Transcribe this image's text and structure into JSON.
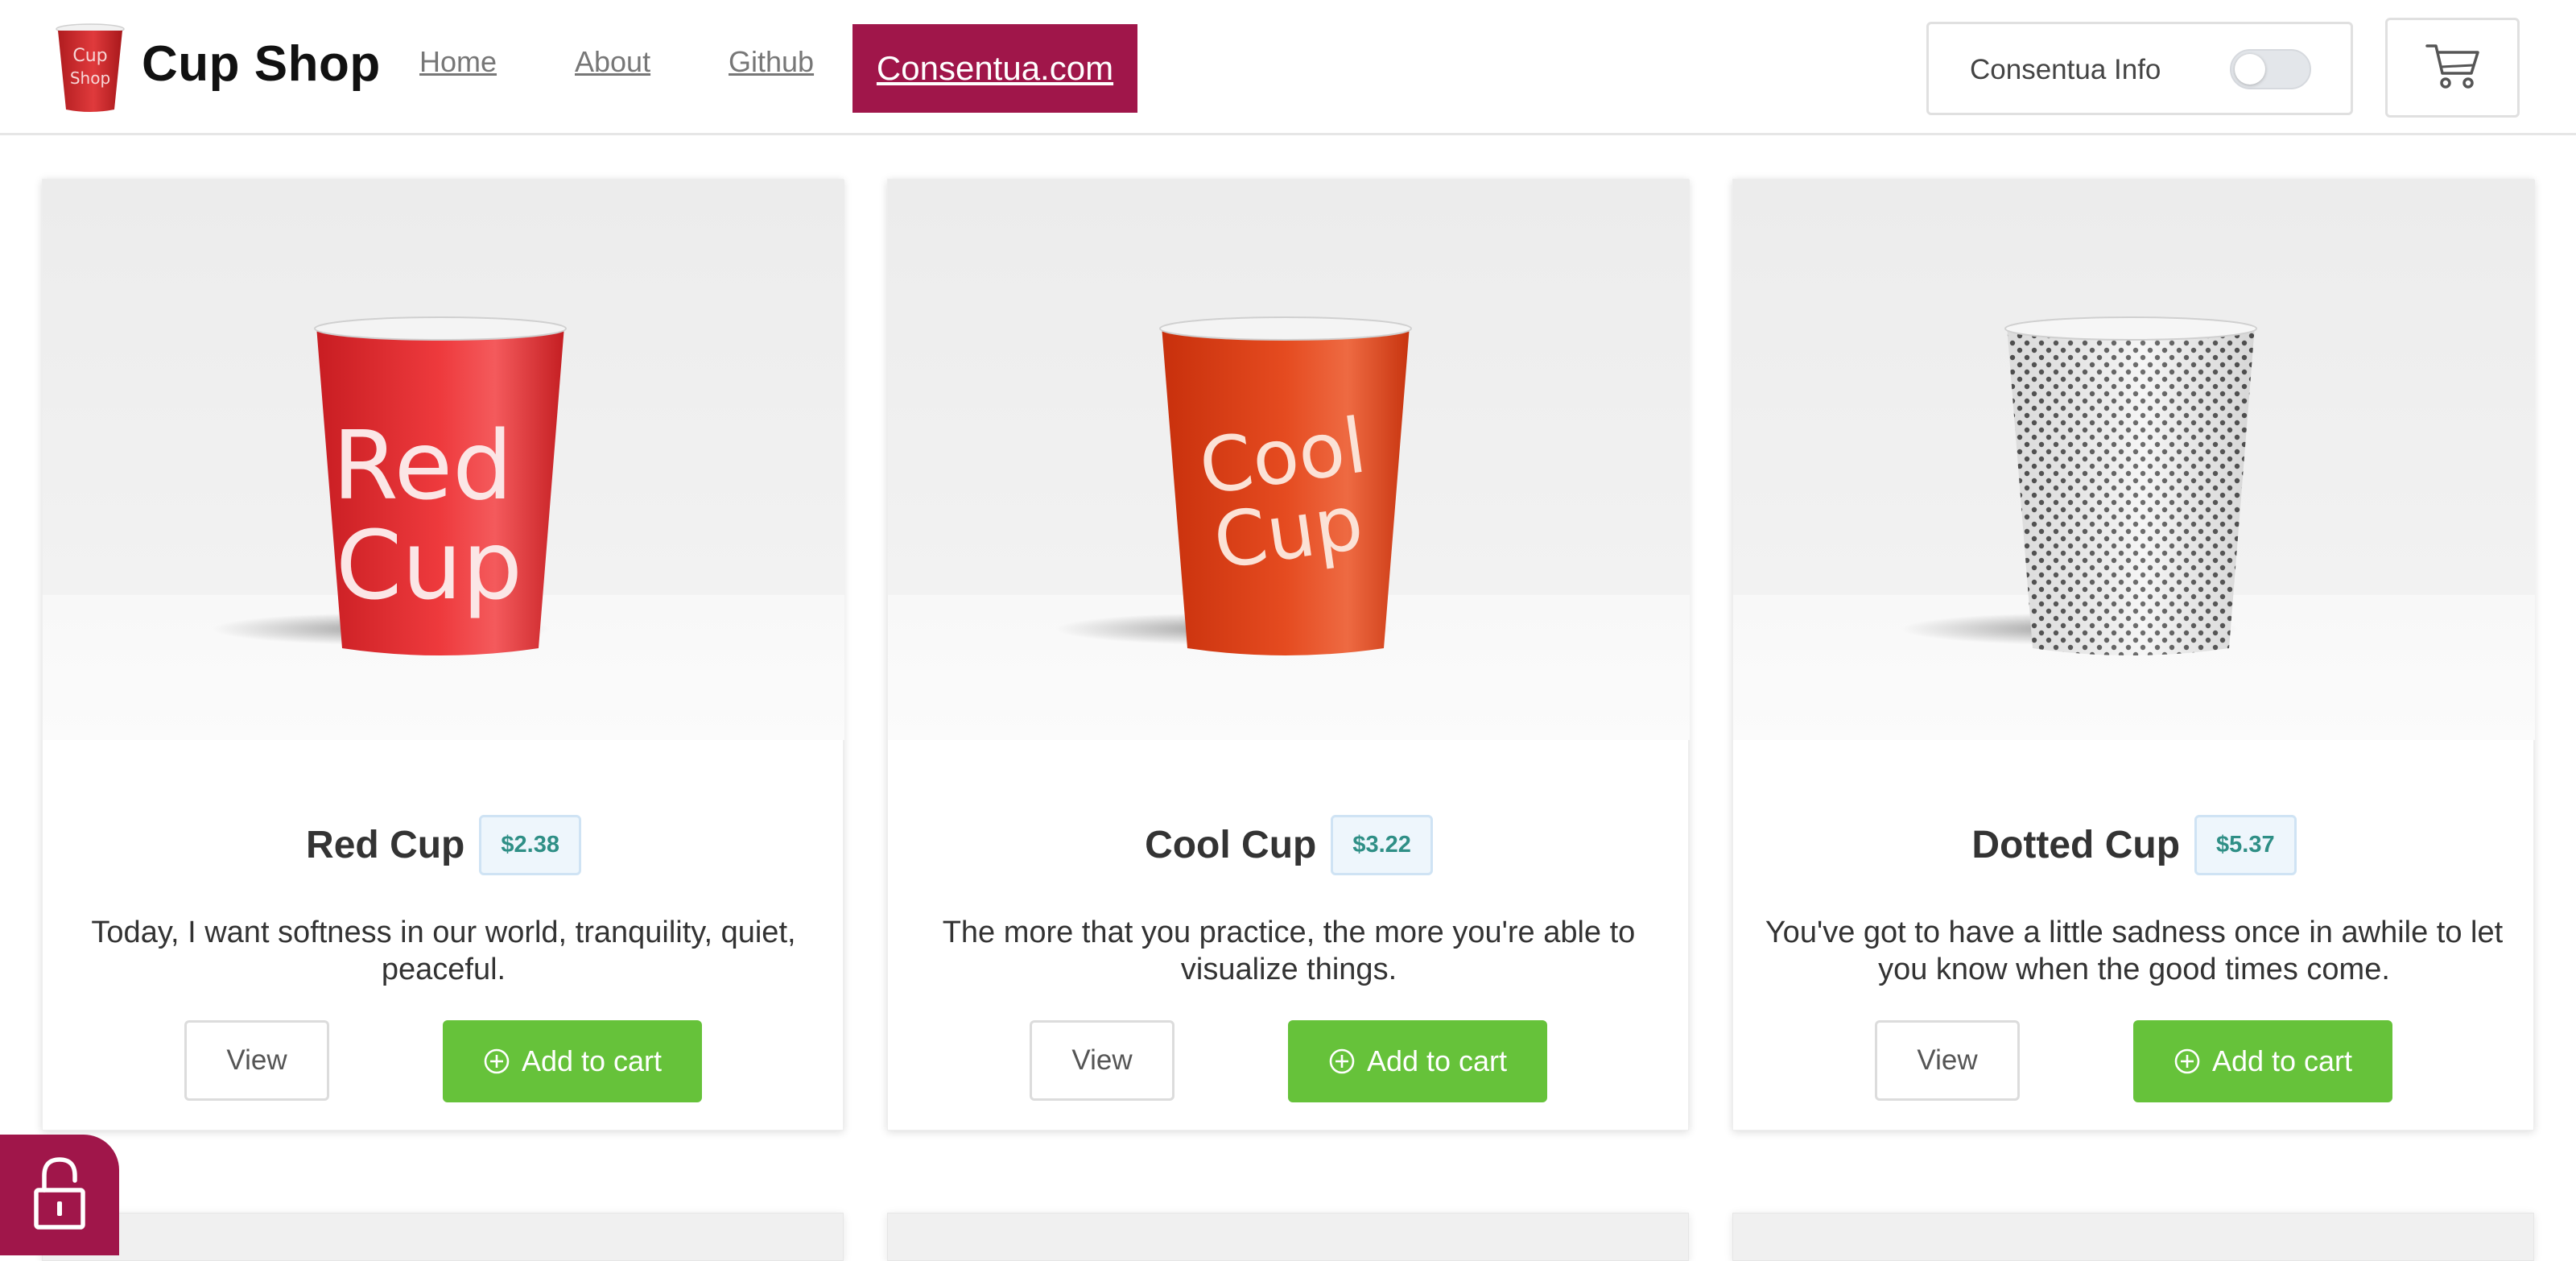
{
  "header": {
    "logo_text_line1": "Cup",
    "logo_text_line2": "Shop",
    "brand": "Cup Shop",
    "nav": {
      "home": "Home",
      "about": "About",
      "github": "Github",
      "consentua": "Consentua.com"
    },
    "consentua_info_label": "Consentua Info",
    "consentua_info_enabled": false,
    "cart_icon": "shopping-cart-icon"
  },
  "products": [
    {
      "name": "Red Cup",
      "price": "$2.38",
      "description": "Today, I want softness in our world, tranquility, quiet, peaceful.",
      "cup_text_line1": "Red",
      "cup_text_line2": "Cup",
      "cup_color": "#e8262a",
      "view_label": "View",
      "add_label": "Add to cart"
    },
    {
      "name": "Cool Cup",
      "price": "$3.22",
      "description": "The more that you practice, the more you're able to visualize things.",
      "cup_text_line1": "Cool",
      "cup_text_line2": "Cup",
      "cup_color": "#e24a1c",
      "view_label": "View",
      "add_label": "Add to cart"
    },
    {
      "name": "Dotted Cup",
      "price": "$5.37",
      "description": "You've got to have a little sadness once in awhile to let you know when the good times come.",
      "cup_color": "#f4f4f4",
      "view_label": "View",
      "add_label": "Add to cart"
    }
  ],
  "colors": {
    "brand_accent": "#a0164a",
    "add_to_cart": "#66c23a",
    "price_text": "#2f8f86"
  },
  "lock_tab_icon": "unlocked-padlock-icon"
}
